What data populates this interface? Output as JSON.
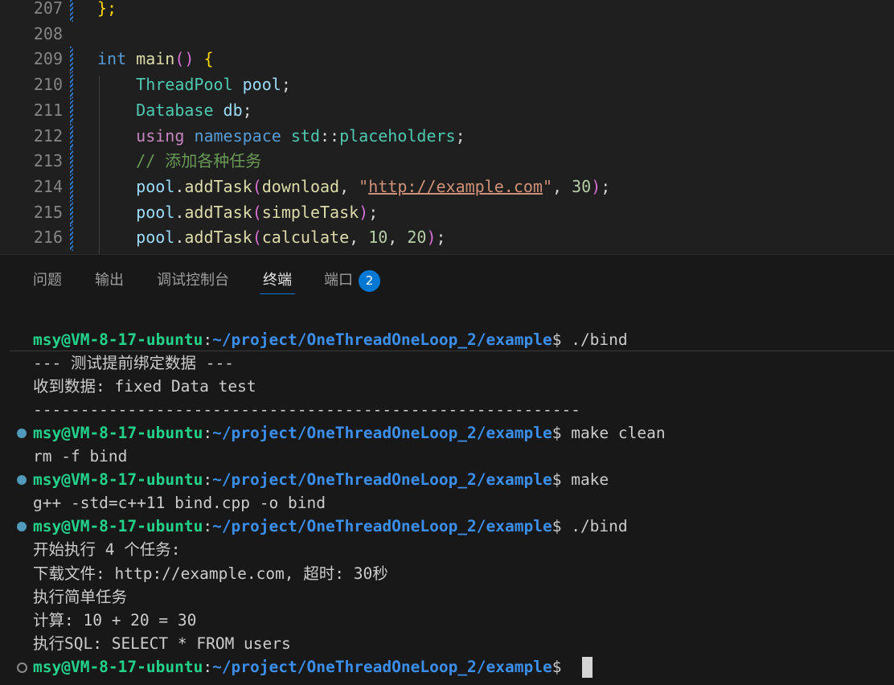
{
  "editor": {
    "lines": [
      {
        "num": "207",
        "tokens": [
          {
            "t": "};",
            "c": "br1"
          }
        ]
      },
      {
        "num": "208",
        "tokens": []
      },
      {
        "num": "209",
        "tokens": [
          {
            "t": "int",
            "c": "kw"
          },
          {
            "t": " ",
            "c": "pun"
          },
          {
            "t": "main",
            "c": "fn"
          },
          {
            "t": "()",
            "c": "br2"
          },
          {
            "t": " ",
            "c": "pun"
          },
          {
            "t": "{",
            "c": "br1"
          }
        ]
      },
      {
        "num": "210",
        "tokens": [
          {
            "t": "    ",
            "c": "pun"
          },
          {
            "t": "ThreadPool",
            "c": "ty"
          },
          {
            "t": " ",
            "c": "pun"
          },
          {
            "t": "pool",
            "c": "var"
          },
          {
            "t": ";",
            "c": "pun"
          }
        ]
      },
      {
        "num": "211",
        "tokens": [
          {
            "t": "    ",
            "c": "pun"
          },
          {
            "t": "Database",
            "c": "ty"
          },
          {
            "t": " ",
            "c": "pun"
          },
          {
            "t": "db",
            "c": "var"
          },
          {
            "t": ";",
            "c": "pun"
          }
        ]
      },
      {
        "num": "212",
        "tokens": [
          {
            "t": "    ",
            "c": "pun"
          },
          {
            "t": "using",
            "c": "ctl"
          },
          {
            "t": " ",
            "c": "pun"
          },
          {
            "t": "namespace",
            "c": "kw"
          },
          {
            "t": " ",
            "c": "pun"
          },
          {
            "t": "std",
            "c": "ty"
          },
          {
            "t": "::",
            "c": "pun"
          },
          {
            "t": "placeholders",
            "c": "ty"
          },
          {
            "t": ";",
            "c": "pun"
          }
        ]
      },
      {
        "num": "213",
        "tokens": [
          {
            "t": "    ",
            "c": "pun"
          },
          {
            "t": "// 添加各种任务",
            "c": "cmt"
          }
        ]
      },
      {
        "num": "214",
        "tokens": [
          {
            "t": "    ",
            "c": "pun"
          },
          {
            "t": "pool",
            "c": "var"
          },
          {
            "t": ".",
            "c": "pun"
          },
          {
            "t": "addTask",
            "c": "fn"
          },
          {
            "t": "(",
            "c": "br2"
          },
          {
            "t": "download",
            "c": "fn"
          },
          {
            "t": ", ",
            "c": "pun"
          },
          {
            "t": "\"",
            "c": "str"
          },
          {
            "t": "http://example.com",
            "c": "url"
          },
          {
            "t": "\"",
            "c": "str"
          },
          {
            "t": ", ",
            "c": "pun"
          },
          {
            "t": "30",
            "c": "num"
          },
          {
            "t": ")",
            "c": "br2"
          },
          {
            "t": ";",
            "c": "pun"
          }
        ]
      },
      {
        "num": "215",
        "tokens": [
          {
            "t": "    ",
            "c": "pun"
          },
          {
            "t": "pool",
            "c": "var"
          },
          {
            "t": ".",
            "c": "pun"
          },
          {
            "t": "addTask",
            "c": "fn"
          },
          {
            "t": "(",
            "c": "br2"
          },
          {
            "t": "simpleTask",
            "c": "fn"
          },
          {
            "t": ")",
            "c": "br2"
          },
          {
            "t": ";",
            "c": "pun"
          }
        ]
      },
      {
        "num": "216",
        "tokens": [
          {
            "t": "    ",
            "c": "pun"
          },
          {
            "t": "pool",
            "c": "var"
          },
          {
            "t": ".",
            "c": "pun"
          },
          {
            "t": "addTask",
            "c": "fn"
          },
          {
            "t": "(",
            "c": "br2"
          },
          {
            "t": "calculate",
            "c": "fn"
          },
          {
            "t": ", ",
            "c": "pun"
          },
          {
            "t": "10",
            "c": "num"
          },
          {
            "t": ", ",
            "c": "pun"
          },
          {
            "t": "20",
            "c": "num"
          },
          {
            "t": ")",
            "c": "br2"
          },
          {
            "t": ";",
            "c": "pun"
          }
        ]
      }
    ]
  },
  "panel": {
    "tabs": [
      {
        "label": "问题",
        "active": false
      },
      {
        "label": "输出",
        "active": false
      },
      {
        "label": "调试控制台",
        "active": false
      },
      {
        "label": "终端",
        "active": true
      },
      {
        "label": "端口",
        "active": false
      }
    ],
    "ports_badge": "2"
  },
  "terminal": {
    "prompt_user": "msy@VM-8-17-ubuntu",
    "prompt_colon": ":",
    "prompt_path": "~/project/OneThreadOneLoop_2/example",
    "prompt_dollar": "$ ",
    "lines": [
      {
        "kind": "prompt",
        "dot": "none",
        "cmd": "./bind"
      },
      {
        "kind": "out",
        "text": "--- 测试提前绑定数据 ---"
      },
      {
        "kind": "out",
        "text": "收到数据: fixed Data test"
      },
      {
        "kind": "out",
        "text": "----------------------------------------------------------"
      },
      {
        "kind": "prompt",
        "dot": "filled",
        "cmd": "make clean"
      },
      {
        "kind": "out",
        "text": "rm -f bind"
      },
      {
        "kind": "prompt",
        "dot": "filled",
        "cmd": "make"
      },
      {
        "kind": "out",
        "text": "g++ -std=c++11 bind.cpp -o bind"
      },
      {
        "kind": "prompt",
        "dot": "filled",
        "cmd": "./bind"
      },
      {
        "kind": "out",
        "text": "开始执行 4 个任务:"
      },
      {
        "kind": "out",
        "text": "下载文件: http://example.com, 超时: 30秒"
      },
      {
        "kind": "out",
        "text": "执行简单任务"
      },
      {
        "kind": "out",
        "text": "计算: 10 + 20 = 30"
      },
      {
        "kind": "out",
        "text": "执行SQL: SELECT * FROM users"
      },
      {
        "kind": "prompt",
        "dot": "hollow",
        "cmd": ""
      }
    ]
  }
}
